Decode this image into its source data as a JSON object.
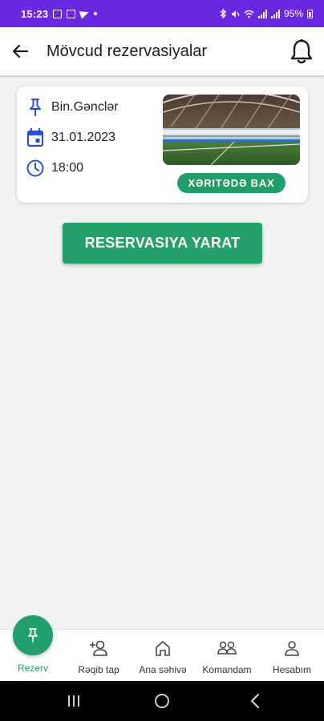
{
  "status_bar": {
    "time": "15:23",
    "battery": "95%"
  },
  "header": {
    "title": "Mövcud rezervasiyalar",
    "back_icon": "arrow-left-icon",
    "notification_icon": "bell-icon"
  },
  "reservation": {
    "venue": "Bin.Gənclər",
    "date": "31.01.2023",
    "time": "18:00",
    "map_button": "XƏRITƏDƏ BAX"
  },
  "create_button": "RESERVASIYA YARAT",
  "bottom_nav": {
    "items": [
      {
        "label": "Rezerv",
        "icon": "pin-icon",
        "active": true
      },
      {
        "label": "Rəqib tap",
        "icon": "add-person-icon",
        "active": false
      },
      {
        "label": "Ana səhivə",
        "icon": "home-icon",
        "active": false
      },
      {
        "label": "Komandam",
        "icon": "team-icon",
        "active": false
      },
      {
        "label": "Hesabım",
        "icon": "person-icon",
        "active": false
      }
    ]
  },
  "colors": {
    "status_bar": "#6a27e0",
    "accent_green": "#22a06b",
    "icon_blue": "#2a4fd6"
  }
}
